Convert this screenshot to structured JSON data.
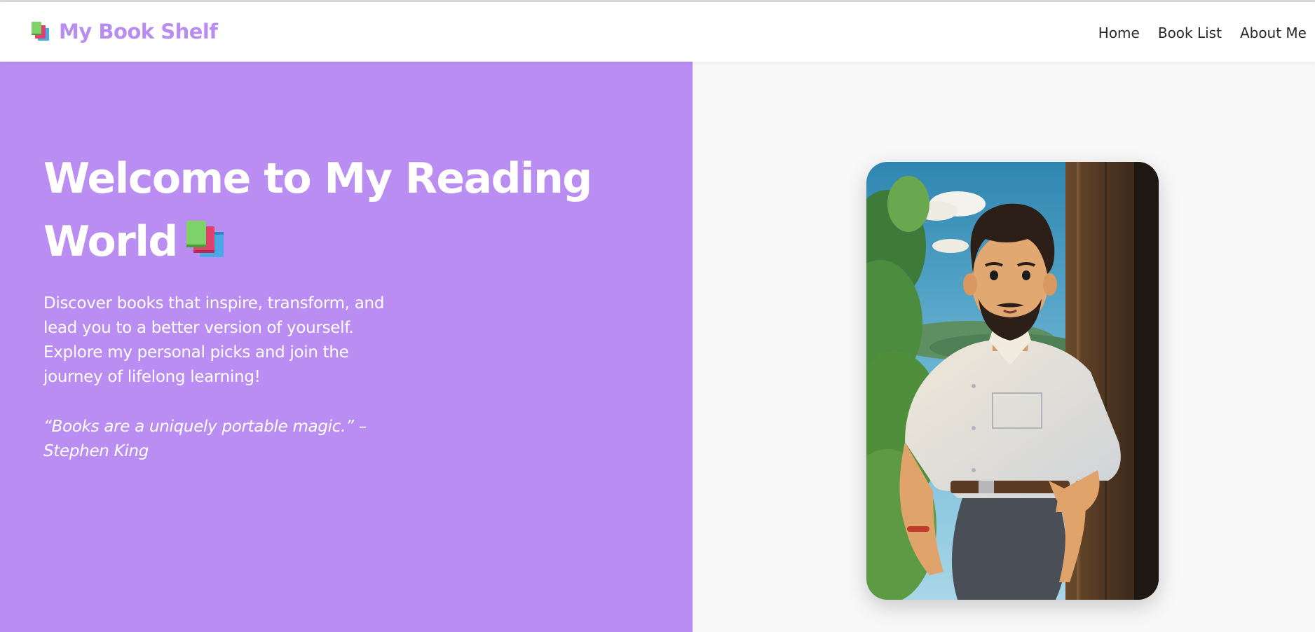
{
  "brand": {
    "icon": "books-icon",
    "title": "My Book Shelf",
    "color": "#b98df0"
  },
  "nav": {
    "items": [
      {
        "label": "Home"
      },
      {
        "label": "Book List"
      },
      {
        "label": "About Me"
      }
    ]
  },
  "hero": {
    "title": "Welcome to My Reading World",
    "title_icon": "books-icon",
    "description": "Discover books that inspire, transform, and lead you to a better version of yourself. Explore my personal picks and join the journey of lifelong learning!",
    "quote": "“Books are a uniquely portable magic.” – Stephen King",
    "background": "#b98df2"
  },
  "portrait": {
    "subject": "illustrated-man-portrait"
  }
}
